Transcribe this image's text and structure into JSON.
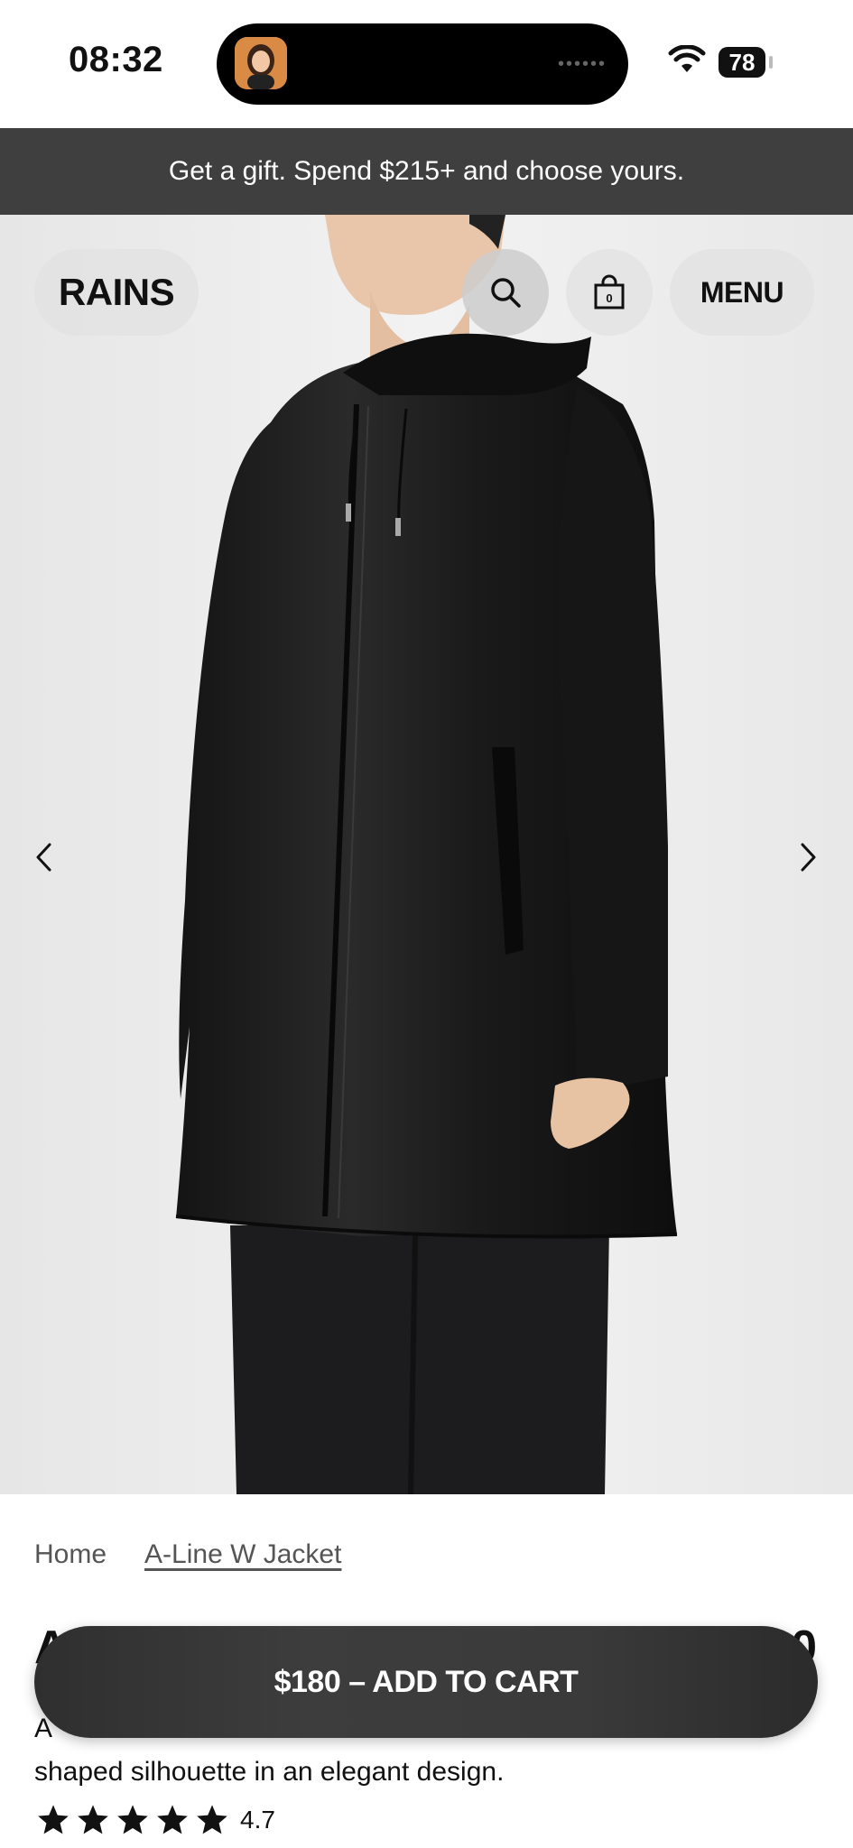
{
  "status": {
    "time": "08:32",
    "battery": "78"
  },
  "promo": {
    "text": "Get a gift. Spend $215+ and choose yours."
  },
  "header": {
    "logo": "RAINS",
    "menu_label": "MENU"
  },
  "breadcrumb": {
    "home": "Home",
    "current": "A-Line W Jacket"
  },
  "product": {
    "title_peek": "A",
    "price_peek": "$180",
    "description_peek": "A",
    "description_line2": "shaped silhouette in an elegant design.",
    "rating": "4.7"
  },
  "cta": {
    "label": "$180 – ADD TO CART"
  },
  "icons": {
    "search": "search-icon",
    "bag": "shopping-bag-icon",
    "prev": "chevron-left-icon",
    "next": "chevron-right-icon",
    "wifi": "wifi-icon",
    "star": "star-icon"
  }
}
